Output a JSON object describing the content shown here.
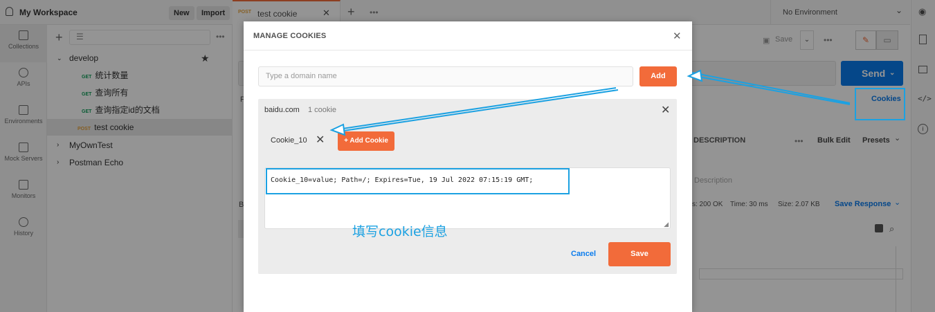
{
  "workspace": {
    "title": "My Workspace",
    "new_label": "New",
    "import_label": "Import"
  },
  "rail": [
    {
      "label": "Collections"
    },
    {
      "label": "APIs"
    },
    {
      "label": "Environments"
    },
    {
      "label": "Mock Servers"
    },
    {
      "label": "Monitors"
    },
    {
      "label": "History"
    }
  ],
  "tree": {
    "develop": "develop",
    "items": [
      {
        "method": "GET",
        "label": "统计数量"
      },
      {
        "method": "GET",
        "label": "查询所有"
      },
      {
        "method": "GET",
        "label": "查询指定id的文档"
      },
      {
        "method": "POST",
        "label": "test cookie"
      }
    ],
    "folders": [
      "MyOwnTest",
      "Postman Echo"
    ]
  },
  "tab": {
    "method": "POST",
    "label": "test cookie"
  },
  "environment": "No Environment",
  "main": {
    "save": "Save",
    "send": "Send",
    "cookies_link": "Cookies",
    "description_header": "DESCRIPTION",
    "bulk_edit": "Bulk Edit",
    "presets": "Presets",
    "description_placeholder": "Description",
    "status": "s: 200 OK",
    "time": "Time: 30 ms",
    "size": "Size: 2.07 KB",
    "save_response": "Save Response",
    "letter_p": "P",
    "letter_b": "B"
  },
  "modal": {
    "title": "MANAGE COOKIES",
    "domain_placeholder": "Type a domain name",
    "add_label": "Add",
    "domain": "baidu.com",
    "cookie_count": "1 cookie",
    "cookie_name": "Cookie_10",
    "add_cookie_label": "+ Add Cookie",
    "cookie_value": "Cookie_10=value; Path=/; Expires=Tue, 19 Jul 2022 07:15:19 GMT;",
    "cancel_label": "Cancel",
    "save_label": "Save"
  },
  "annotation": {
    "text": "填写cookie信息",
    "color": "#1ba1e2"
  }
}
